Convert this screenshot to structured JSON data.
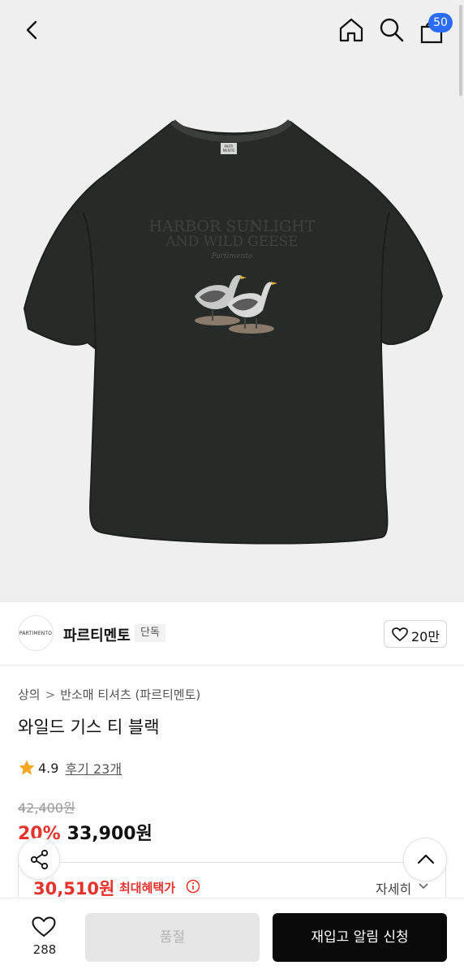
{
  "header": {
    "back_icon": "chevron-left-icon",
    "home_icon": "home-icon",
    "search_icon": "search-icon",
    "cart_icon": "shopping-bag-icon",
    "cart_count": "50"
  },
  "product_image": {
    "print_line_1": "HARBOR SUNLIGHT",
    "print_line_2": "AND WILD GEESE",
    "print_signature": "Partimento",
    "neck_label": "PARTI MENTO"
  },
  "brand": {
    "logo_text": "PARTIMENTO",
    "name": "파르티멘토",
    "tag": "단독",
    "likes": "20만"
  },
  "breadcrumb": {
    "category": "상의",
    "separator": ">",
    "subcategory": "반소매 티셔츠 (파르티멘토)"
  },
  "product": {
    "title": "와일드 기스 티 블랙",
    "rating": "4.9",
    "reviews": "후기 23개",
    "original_price": "42,400원",
    "discount": "20%",
    "sale_price": "33,900원"
  },
  "benefit": {
    "price": "30,510원",
    "label": "최대혜택가",
    "detail": "자세히"
  },
  "bottom": {
    "wish_count": "288",
    "soldout_label": "품절",
    "restock_label": "재입고 알림 신청"
  },
  "colors": {
    "accent_red": "#e5322d",
    "badge_blue": "#2b6cf6",
    "star": "#f5a623",
    "shirt": "#272b28"
  }
}
